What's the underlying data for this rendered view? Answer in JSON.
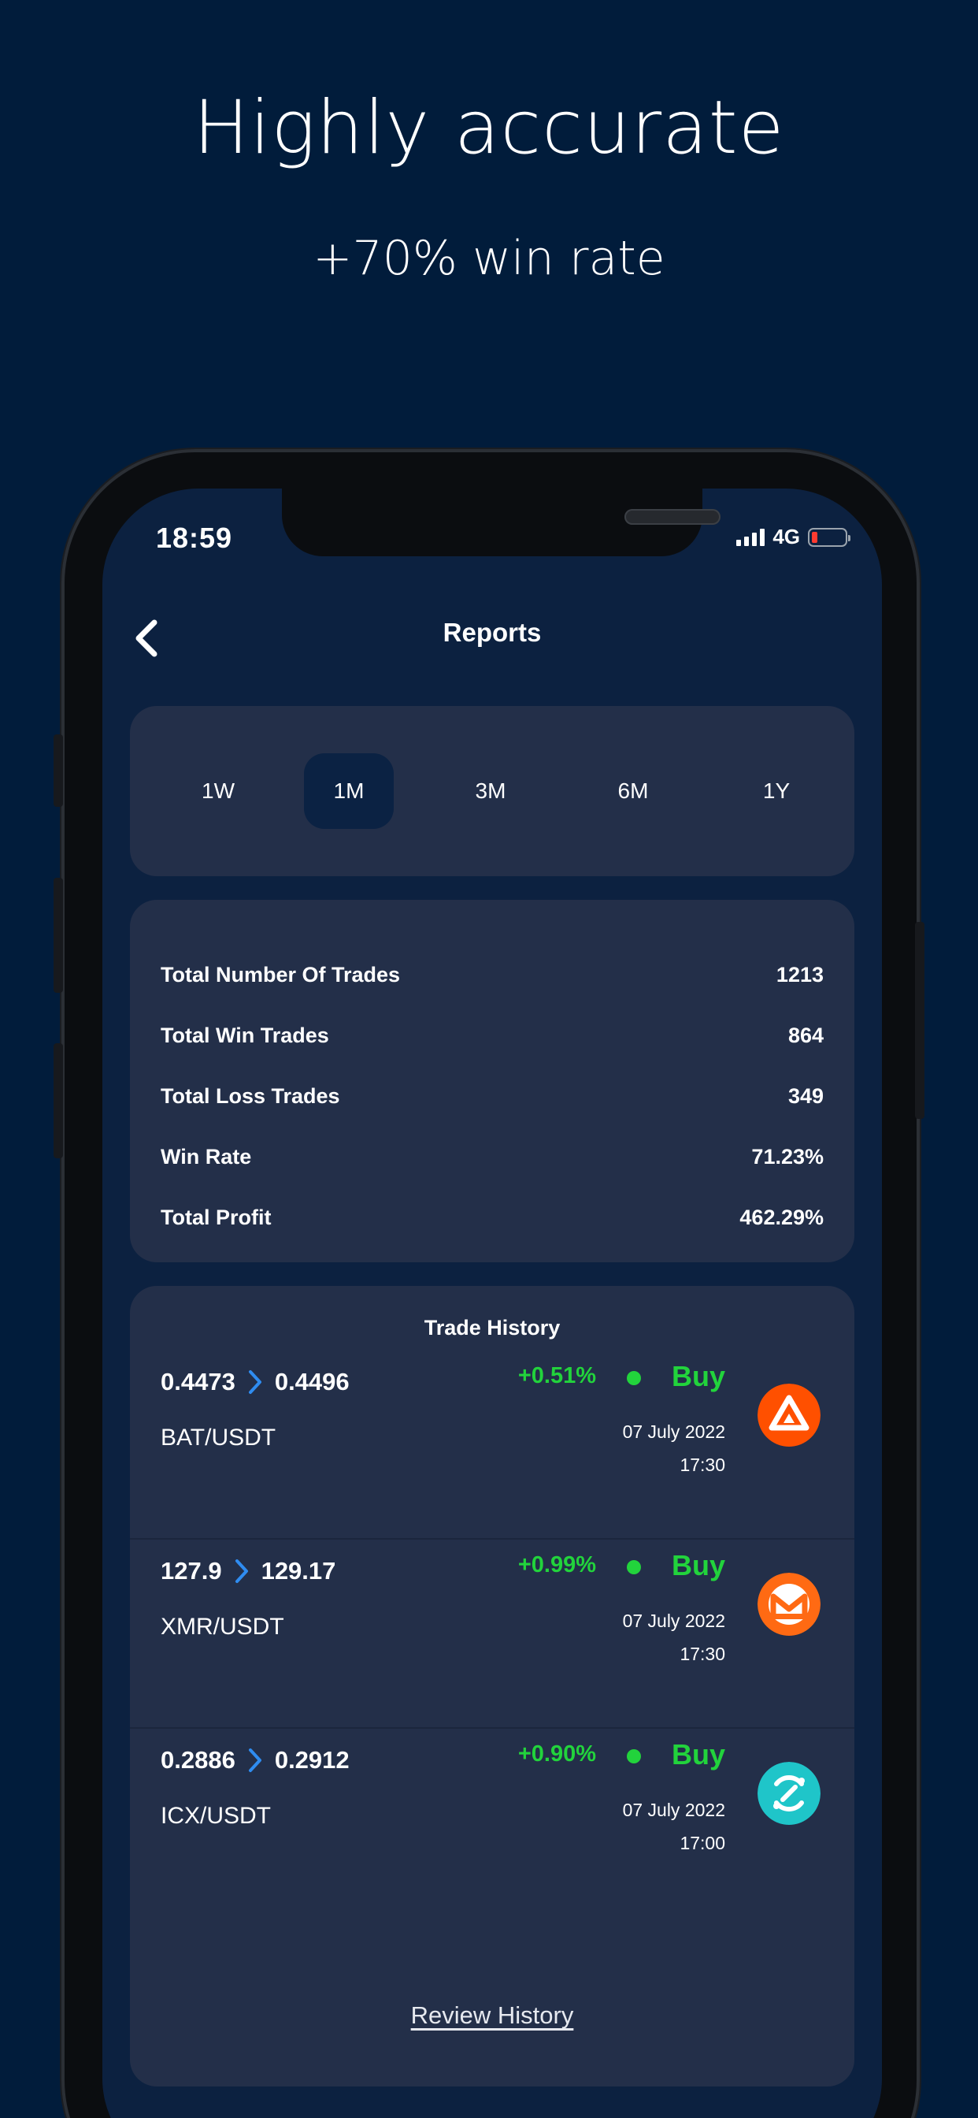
{
  "promo": {
    "headline": "Highly accurate",
    "subline": "+70% win rate"
  },
  "status_bar": {
    "time": "18:59",
    "network": "4G",
    "battery_color": "#ff3b30"
  },
  "nav": {
    "back_icon": "chevron-left-icon",
    "title": "Reports"
  },
  "periods": {
    "options": [
      "1W",
      "1M",
      "3M",
      "6M",
      "1Y"
    ],
    "selected": "1M"
  },
  "stats": [
    {
      "label": "Total Number Of Trades",
      "value": "1213"
    },
    {
      "label": "Total Win Trades",
      "value": "864"
    },
    {
      "label": "Total Loss Trades",
      "value": "349"
    },
    {
      "label": "Win Rate",
      "value": "71.23%"
    },
    {
      "label": "Total Profit",
      "value": "462.29%"
    }
  ],
  "trade_history": {
    "title": "Trade History",
    "trades": [
      {
        "entry": "0.4473",
        "exit": "0.4496",
        "pair": "BAT/USDT",
        "change": "+0.51%",
        "side": "Buy",
        "date": "07 July 2022",
        "time": "17:30",
        "coin_icon": "bat-coin-icon",
        "coin_color": "#ff5000"
      },
      {
        "entry": "127.9",
        "exit": "129.17",
        "pair": "XMR/USDT",
        "change": "+0.99%",
        "side": "Buy",
        "date": "07 July 2022",
        "time": "17:30",
        "coin_icon": "monero-coin-icon",
        "coin_color": "#ff6a13"
      },
      {
        "entry": "0.2886",
        "exit": "0.2912",
        "pair": "ICX/USDT",
        "change": "+0.90%",
        "side": "Buy",
        "date": "07 July 2022",
        "time": "17:00",
        "coin_icon": "icon-coin-icon",
        "coin_color": "#1fc5c9"
      }
    ],
    "review_label": "Review History"
  },
  "colors": {
    "background": "#011c3b",
    "screen": "#0c2140",
    "card": "#232f49",
    "positive": "#22d33c",
    "arrow": "#2f8cf0"
  }
}
